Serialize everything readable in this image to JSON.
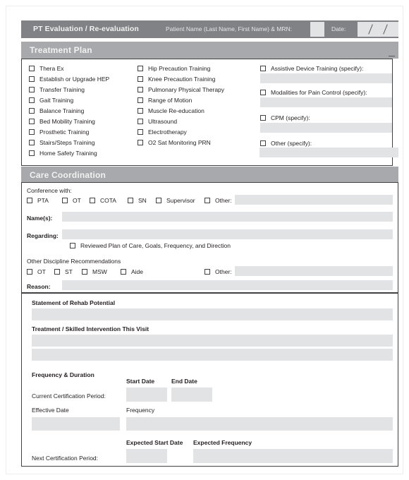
{
  "header": {
    "form_title": "PT Evaluation / Re-evaluation",
    "patient_label": "Patient Name (Last Name, First Name) & MRN:",
    "patient_value": "",
    "date_label": "Date:",
    "date_value": ""
  },
  "treatment_plan": {
    "section_title": "Treatment Plan",
    "column1": [
      "Thera Ex",
      "Establish or Upgrade HEP",
      "Transfer Training",
      "Gait Training",
      "Balance Training",
      "Bed Mobility Training",
      "Prosthetic Training",
      "Stairs/Steps Training",
      "Home Safety Training"
    ],
    "column2": [
      "Hip Precaution Training",
      "Knee Precaution Training",
      "Pulmonary Physical Therapy",
      "Range of Motion",
      "Muscle Re-education",
      "Ultrasound",
      "Electrotherapy",
      "O2 Sat Monitoring PRN"
    ],
    "column3": [
      {
        "label": "Assistive Device Training (specify):",
        "value": ""
      },
      {
        "label": "Modalities for Pain Control (specify):",
        "value": ""
      },
      {
        "label": "CPM (specify):",
        "value": ""
      },
      {
        "label": "Other (specify):",
        "value": ""
      }
    ]
  },
  "care_coordination": {
    "section_title": "Care Coordination",
    "conference_label": "Conference with:",
    "conference_options": [
      "PTA",
      "OT",
      "COTA",
      "SN",
      "Supervisor"
    ],
    "conference_other_label": "Other:",
    "conference_other_value": "",
    "names_label": "Name(s):",
    "names_value": "",
    "regarding_label": "Regarding:",
    "regarding_value": "",
    "reviewed_label": "Reviewed Plan of Care, Goals, Frequency, and Direction",
    "other_discipline_label": "Other Discipline Recommendations",
    "other_discipline_options": [
      "OT",
      "ST",
      "MSW",
      "Aide"
    ],
    "other_discipline_other_label": "Other:",
    "other_discipline_other_value": "",
    "reason_label": "Reason:",
    "reason_value": ""
  },
  "rehab": {
    "statement_label": "Statement of Rehab Potential",
    "statement_value": "",
    "treatment_label": "Treatment / Skilled Intervention This Visit",
    "treatment_line1": "",
    "treatment_line2": ""
  },
  "frequency": {
    "heading": "Frequency & Duration",
    "start_date_label": "Start Date",
    "end_date_label": "End Date",
    "current_period_label": "Current Certification Period:",
    "current_start_value": "",
    "current_end_value": "",
    "effective_date_label": "Effective Date",
    "effective_date_value": "",
    "frequency_label": "Frequency",
    "frequency_value": "",
    "expected_start_label": "Expected Start Date",
    "expected_frequency_label": "Expected Frequency",
    "next_period_label": "Next Certification Period:",
    "next_start_value": "",
    "next_frequency_value": ""
  },
  "colors": {
    "top_bar": "#808285",
    "section_bar": "#a7a9ac",
    "field_fill": "#e2e3e5",
    "border": "#414042",
    "text": "#231f20"
  }
}
